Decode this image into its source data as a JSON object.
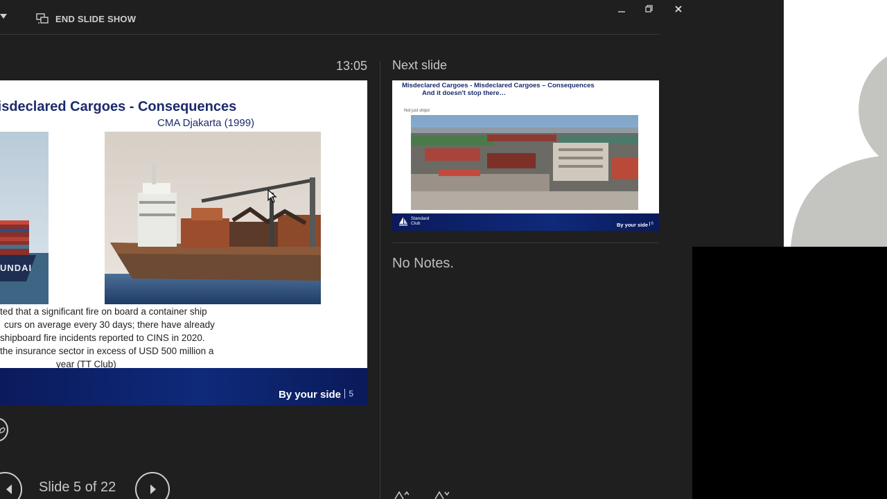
{
  "toolbar": {
    "end_slide_show_label": "END SLIDE SHOW",
    "icons": [
      "dropdown-arrow-icon",
      "presenter-display-icon",
      "minimize-icon",
      "restore-icon",
      "close-icon"
    ]
  },
  "presenter": {
    "timer": "13:05",
    "current_slide": {
      "title": "Misdeclared Cargoes - Consequences",
      "subtitle": "CMA Djakarta (1999)",
      "ship_label": "UNDAI",
      "body_lines": [
        "ted that a significant fire on board a container ship",
        "curs on average every 30 days; there have already",
        "shipboard fire incidents reported to CINS in 2020.",
        " the insurance sector in excess of USD 500 million a",
        "year (TT Club)"
      ],
      "footer_tag": "By your side",
      "footer_number": "5"
    },
    "slide_counter": "Slide 5 of 22",
    "next_slide": {
      "heading": "Next slide",
      "title": "Misdeclared Cargoes - Misdeclared Cargoes – Consequences",
      "subtitle": "And it doesn't stop there…",
      "caption": "Not just ships!",
      "logo_text_1": "Standard",
      "logo_text_2": "Club",
      "footer_tag": "By your side",
      "footer_number": "6"
    },
    "notes": "No Notes."
  },
  "colors": {
    "background": "#1f1f1f",
    "slide_title": "#1b2a6e",
    "slide_footer": "#0f2a7a"
  }
}
